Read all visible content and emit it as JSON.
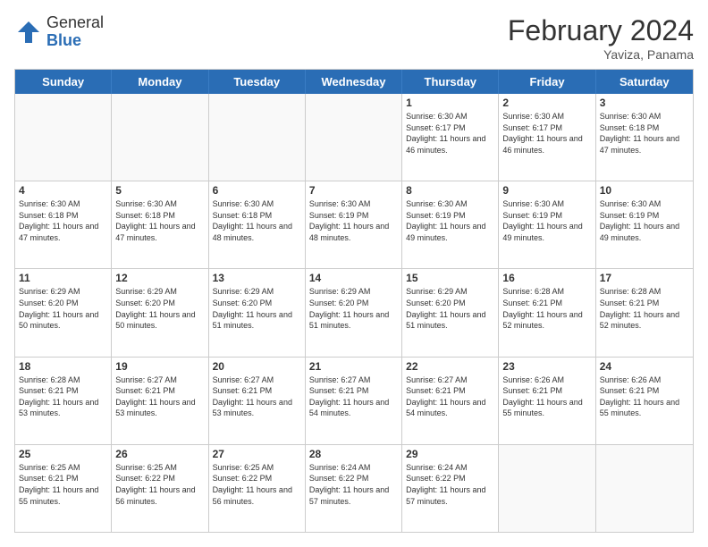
{
  "header": {
    "logo_general": "General",
    "logo_blue": "Blue",
    "month_title": "February 2024",
    "subtitle": "Yaviza, Panama"
  },
  "days_of_week": [
    "Sunday",
    "Monday",
    "Tuesday",
    "Wednesday",
    "Thursday",
    "Friday",
    "Saturday"
  ],
  "weeks": [
    [
      {
        "day": "",
        "info": "",
        "empty": true
      },
      {
        "day": "",
        "info": "",
        "empty": true
      },
      {
        "day": "",
        "info": "",
        "empty": true
      },
      {
        "day": "",
        "info": "",
        "empty": true
      },
      {
        "day": "1",
        "info": "Sunrise: 6:30 AM\nSunset: 6:17 PM\nDaylight: 11 hours and 46 minutes.",
        "empty": false
      },
      {
        "day": "2",
        "info": "Sunrise: 6:30 AM\nSunset: 6:17 PM\nDaylight: 11 hours and 46 minutes.",
        "empty": false
      },
      {
        "day": "3",
        "info": "Sunrise: 6:30 AM\nSunset: 6:18 PM\nDaylight: 11 hours and 47 minutes.",
        "empty": false
      }
    ],
    [
      {
        "day": "4",
        "info": "Sunrise: 6:30 AM\nSunset: 6:18 PM\nDaylight: 11 hours and 47 minutes.",
        "empty": false
      },
      {
        "day": "5",
        "info": "Sunrise: 6:30 AM\nSunset: 6:18 PM\nDaylight: 11 hours and 47 minutes.",
        "empty": false
      },
      {
        "day": "6",
        "info": "Sunrise: 6:30 AM\nSunset: 6:18 PM\nDaylight: 11 hours and 48 minutes.",
        "empty": false
      },
      {
        "day": "7",
        "info": "Sunrise: 6:30 AM\nSunset: 6:19 PM\nDaylight: 11 hours and 48 minutes.",
        "empty": false
      },
      {
        "day": "8",
        "info": "Sunrise: 6:30 AM\nSunset: 6:19 PM\nDaylight: 11 hours and 49 minutes.",
        "empty": false
      },
      {
        "day": "9",
        "info": "Sunrise: 6:30 AM\nSunset: 6:19 PM\nDaylight: 11 hours and 49 minutes.",
        "empty": false
      },
      {
        "day": "10",
        "info": "Sunrise: 6:30 AM\nSunset: 6:19 PM\nDaylight: 11 hours and 49 minutes.",
        "empty": false
      }
    ],
    [
      {
        "day": "11",
        "info": "Sunrise: 6:29 AM\nSunset: 6:20 PM\nDaylight: 11 hours and 50 minutes.",
        "empty": false
      },
      {
        "day": "12",
        "info": "Sunrise: 6:29 AM\nSunset: 6:20 PM\nDaylight: 11 hours and 50 minutes.",
        "empty": false
      },
      {
        "day": "13",
        "info": "Sunrise: 6:29 AM\nSunset: 6:20 PM\nDaylight: 11 hours and 51 minutes.",
        "empty": false
      },
      {
        "day": "14",
        "info": "Sunrise: 6:29 AM\nSunset: 6:20 PM\nDaylight: 11 hours and 51 minutes.",
        "empty": false
      },
      {
        "day": "15",
        "info": "Sunrise: 6:29 AM\nSunset: 6:20 PM\nDaylight: 11 hours and 51 minutes.",
        "empty": false
      },
      {
        "day": "16",
        "info": "Sunrise: 6:28 AM\nSunset: 6:21 PM\nDaylight: 11 hours and 52 minutes.",
        "empty": false
      },
      {
        "day": "17",
        "info": "Sunrise: 6:28 AM\nSunset: 6:21 PM\nDaylight: 11 hours and 52 minutes.",
        "empty": false
      }
    ],
    [
      {
        "day": "18",
        "info": "Sunrise: 6:28 AM\nSunset: 6:21 PM\nDaylight: 11 hours and 53 minutes.",
        "empty": false
      },
      {
        "day": "19",
        "info": "Sunrise: 6:27 AM\nSunset: 6:21 PM\nDaylight: 11 hours and 53 minutes.",
        "empty": false
      },
      {
        "day": "20",
        "info": "Sunrise: 6:27 AM\nSunset: 6:21 PM\nDaylight: 11 hours and 53 minutes.",
        "empty": false
      },
      {
        "day": "21",
        "info": "Sunrise: 6:27 AM\nSunset: 6:21 PM\nDaylight: 11 hours and 54 minutes.",
        "empty": false
      },
      {
        "day": "22",
        "info": "Sunrise: 6:27 AM\nSunset: 6:21 PM\nDaylight: 11 hours and 54 minutes.",
        "empty": false
      },
      {
        "day": "23",
        "info": "Sunrise: 6:26 AM\nSunset: 6:21 PM\nDaylight: 11 hours and 55 minutes.",
        "empty": false
      },
      {
        "day": "24",
        "info": "Sunrise: 6:26 AM\nSunset: 6:21 PM\nDaylight: 11 hours and 55 minutes.",
        "empty": false
      }
    ],
    [
      {
        "day": "25",
        "info": "Sunrise: 6:25 AM\nSunset: 6:21 PM\nDaylight: 11 hours and 55 minutes.",
        "empty": false
      },
      {
        "day": "26",
        "info": "Sunrise: 6:25 AM\nSunset: 6:22 PM\nDaylight: 11 hours and 56 minutes.",
        "empty": false
      },
      {
        "day": "27",
        "info": "Sunrise: 6:25 AM\nSunset: 6:22 PM\nDaylight: 11 hours and 56 minutes.",
        "empty": false
      },
      {
        "day": "28",
        "info": "Sunrise: 6:24 AM\nSunset: 6:22 PM\nDaylight: 11 hours and 57 minutes.",
        "empty": false
      },
      {
        "day": "29",
        "info": "Sunrise: 6:24 AM\nSunset: 6:22 PM\nDaylight: 11 hours and 57 minutes.",
        "empty": false
      },
      {
        "day": "",
        "info": "",
        "empty": true
      },
      {
        "day": "",
        "info": "",
        "empty": true
      }
    ]
  ]
}
